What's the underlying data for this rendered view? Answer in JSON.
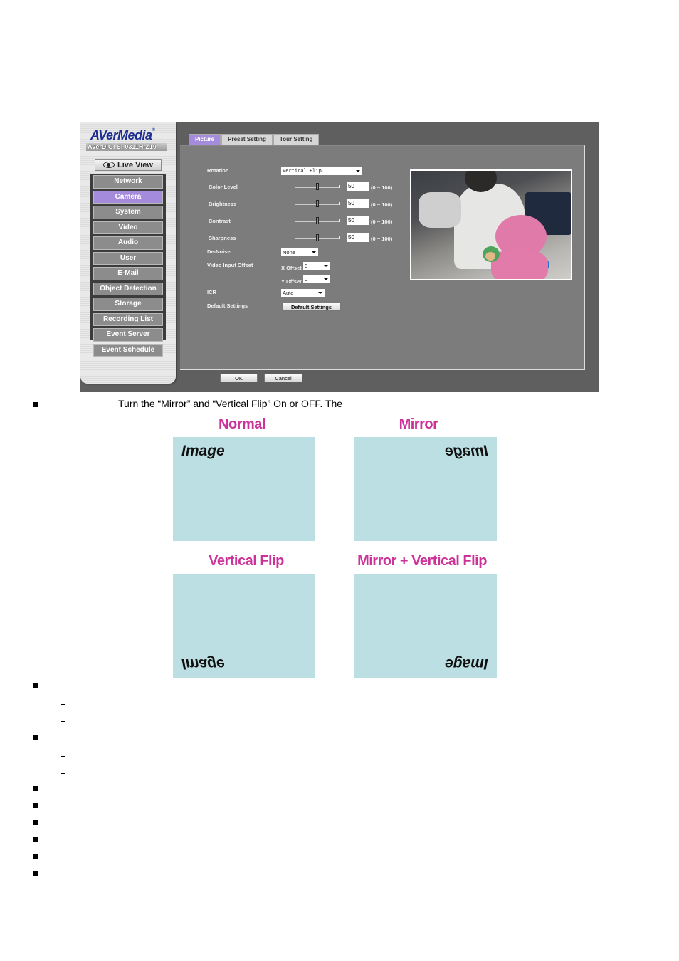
{
  "app": {
    "brand": "AVerMedia",
    "model": "AVerDiGi SF0311H-Z10",
    "live_view_label": "Live View",
    "menu": [
      {
        "label": "Network",
        "active": false
      },
      {
        "label": "Camera",
        "active": true
      },
      {
        "label": "System",
        "active": false
      },
      {
        "label": "Video",
        "active": false
      },
      {
        "label": "Audio",
        "active": false
      },
      {
        "label": "User",
        "active": false
      },
      {
        "label": "E-Mail",
        "active": false
      },
      {
        "label": "Object Detection",
        "active": false
      },
      {
        "label": "Storage",
        "active": false
      },
      {
        "label": "Recording List",
        "active": false
      },
      {
        "label": "Event Server",
        "active": false
      },
      {
        "label": "Event Schedule",
        "active": false
      }
    ],
    "tabs": [
      {
        "label": "Picture",
        "active": true
      },
      {
        "label": "Preset Setting",
        "active": false
      },
      {
        "label": "Tour Setting",
        "active": false
      }
    ],
    "form": {
      "rotation": {
        "label": "Rotation",
        "value": "Vertical Flip"
      },
      "sliders": [
        {
          "label": "Color Level",
          "value": "50",
          "range": "(0 ~ 100)",
          "fraction": 0.5
        },
        {
          "label": "Brightness",
          "value": "50",
          "range": "(0 ~ 100)",
          "fraction": 0.5
        },
        {
          "label": "Contrast",
          "value": "50",
          "range": "(0 ~ 100)",
          "fraction": 0.5
        },
        {
          "label": "Sharpness",
          "value": "50",
          "range": "(0 ~ 100)",
          "fraction": 0.5
        }
      ],
      "denoise": {
        "label": "De-Noise",
        "value": "None"
      },
      "offset": {
        "label": "Video Input Offset",
        "x_label": "X Offset",
        "x_value": "0",
        "y_label": "Y Offset",
        "y_value": "0"
      },
      "icr": {
        "label": "ICR",
        "value": "Auto"
      },
      "defaults": {
        "label": "Default Settings",
        "button": "Default Settings"
      }
    },
    "ok_label": "OK",
    "cancel_label": "Cancel"
  },
  "doc": {
    "intro": "Turn the “Mirror” and “Vertical Flip” On or OFF. The",
    "figure": {
      "sample_text": "Image",
      "panels": [
        {
          "title": "Normal",
          "mode": "normal"
        },
        {
          "title": "Mirror",
          "mode": "mirror"
        },
        {
          "title": "Vertical Flip",
          "mode": "vflip"
        },
        {
          "title": "Mirror + Vertical Flip",
          "mode": "both"
        }
      ]
    }
  },
  "colors": {
    "accent": "#a58bdb",
    "figure_title": "#cc3399",
    "figure_box": "#bbdfe3"
  }
}
